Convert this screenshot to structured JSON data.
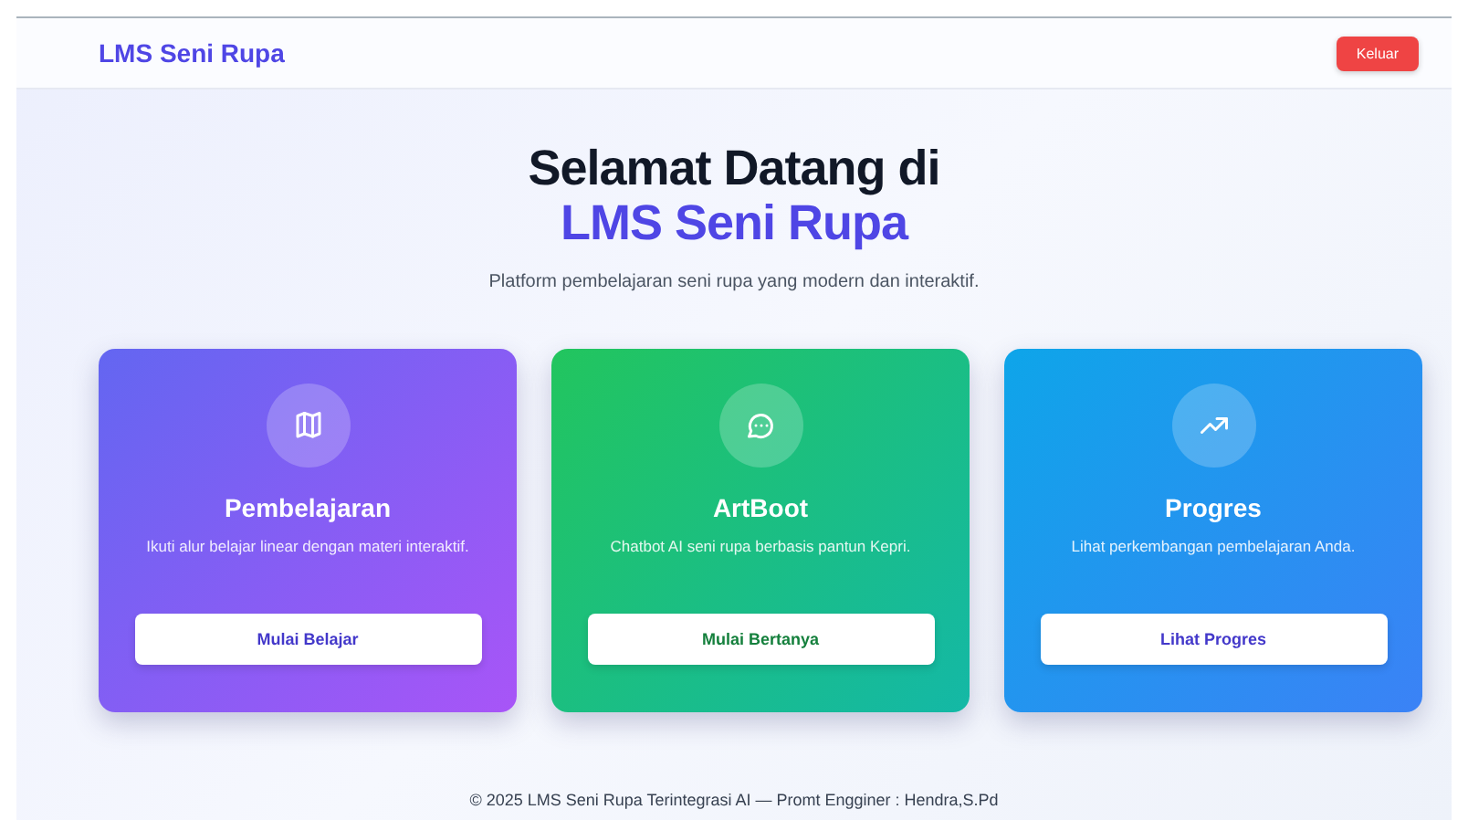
{
  "header": {
    "brand": "LMS Seni Rupa",
    "logout_button": "Keluar"
  },
  "hero": {
    "title_line_1": "Selamat Datang di",
    "title_line_2": "LMS Seni Rupa",
    "subtitle": "Platform pembelajaran seni rupa yang modern dan interaktif."
  },
  "cards": [
    {
      "kind": "learning",
      "title": "Pembelajaran",
      "description": "Ikuti alur belajar linear dengan materi interaktif.",
      "button": "Mulai Belajar"
    },
    {
      "kind": "chat",
      "title": "ArtBoot",
      "description": "Chatbot AI seni rupa berbasis pantun Kepri.",
      "button": "Mulai Bertanya"
    },
    {
      "kind": "progress",
      "title": "Progres",
      "description": "Lihat perkembangan pembelajaran Anda.",
      "button": "Lihat Progres"
    }
  ],
  "footer": "© 2025 LMS Seni Rupa Terintegrasi AI — Promt Engginer : Hendra,S.Pd"
}
